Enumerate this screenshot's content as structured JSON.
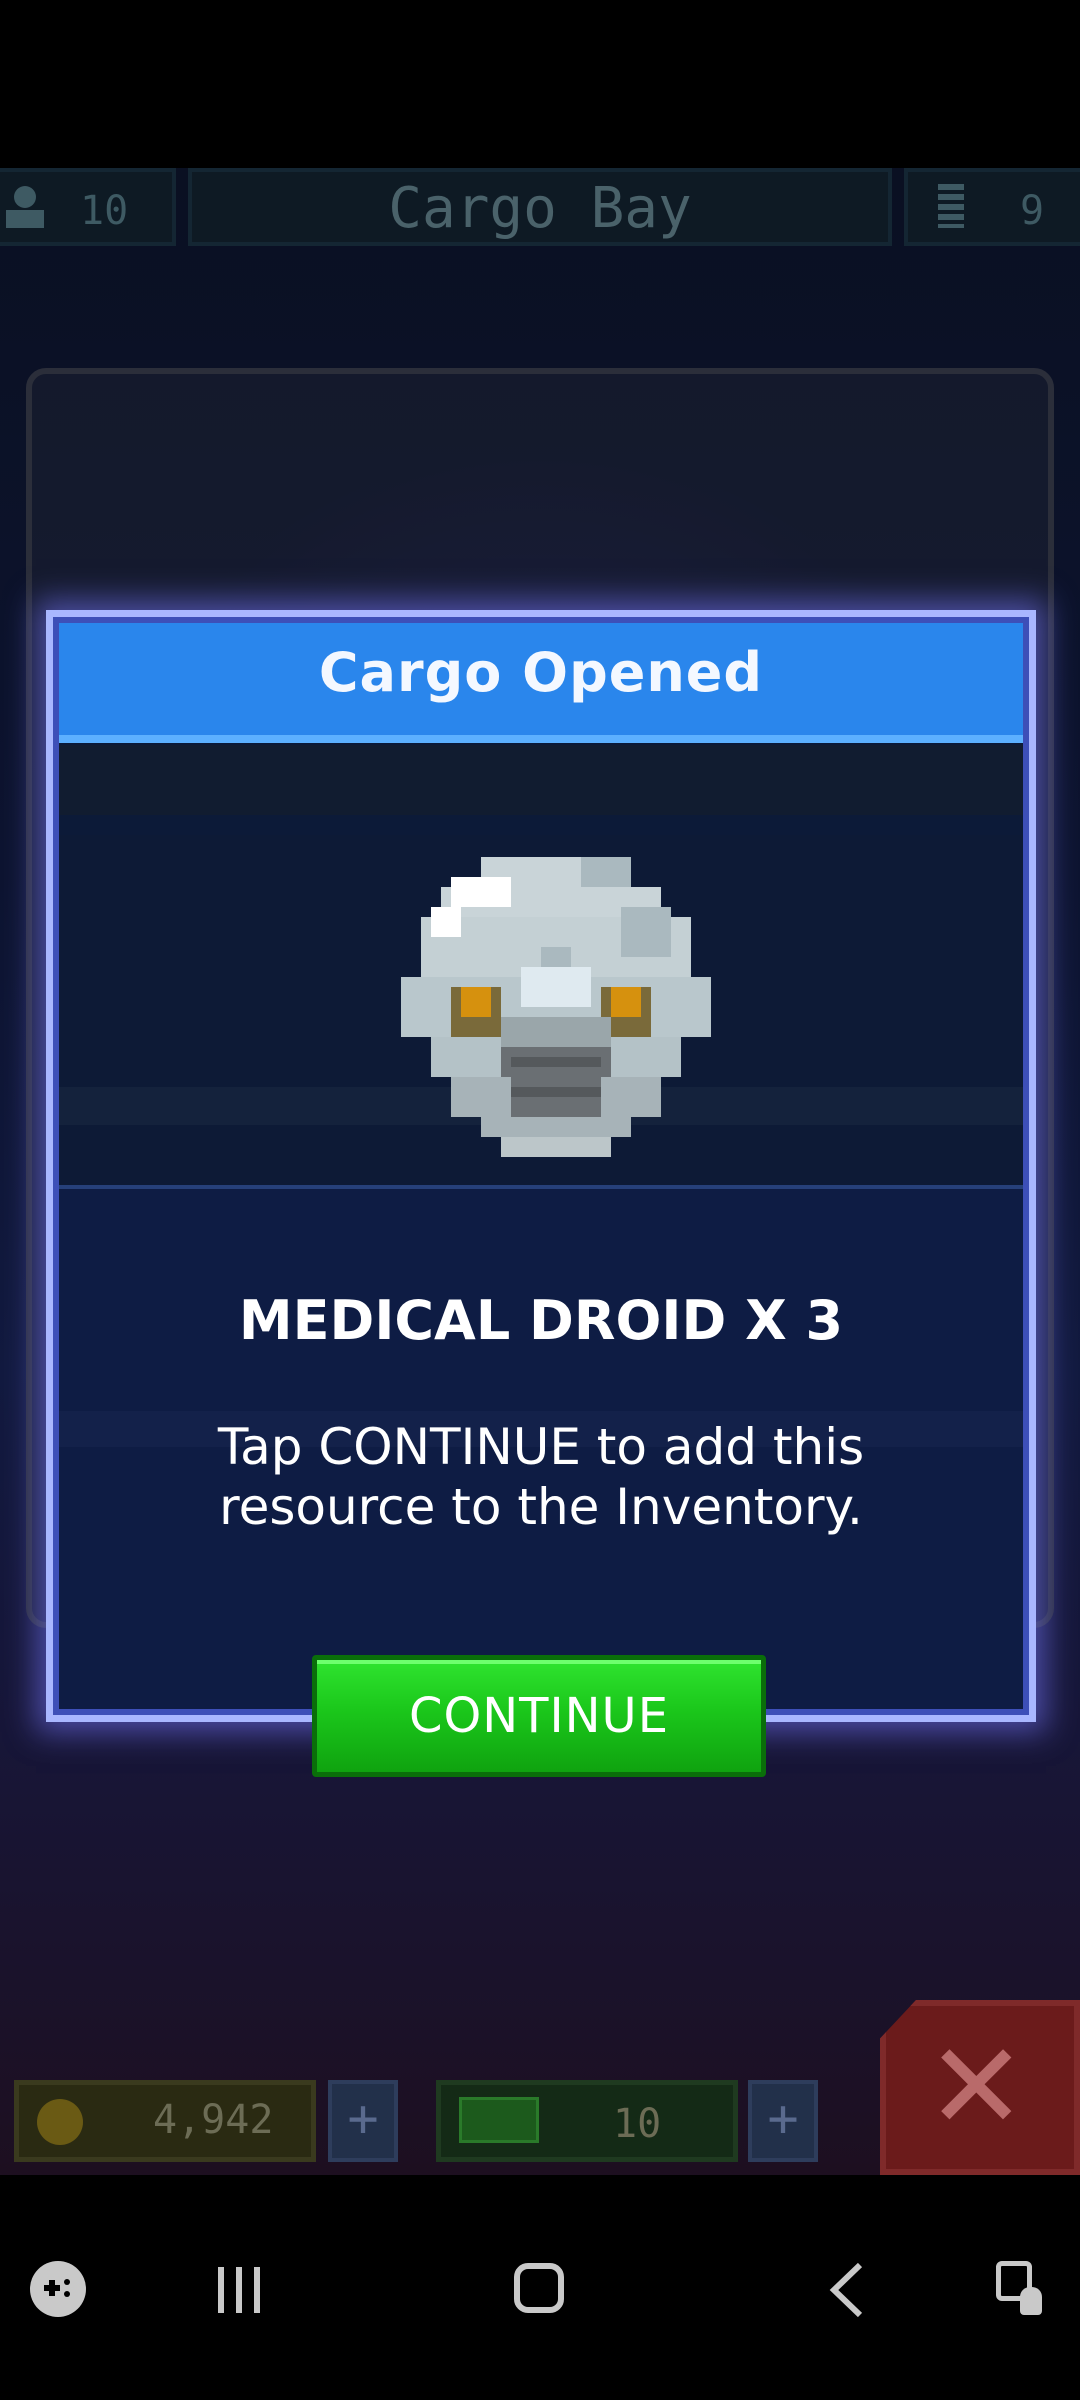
{
  "top_bar": {
    "crew_count": "10",
    "room_title": "Cargo Bay",
    "floor_count": "9"
  },
  "modal": {
    "title": "Cargo Opened",
    "item_name": "MEDICAL DROID X 3",
    "description": "Tap CONTINUE to add this resource to the Inventory.",
    "continue_label": "CONTINUE"
  },
  "resources": {
    "coins": "4,942",
    "tokens": "10"
  },
  "colors": {
    "header_blue": "#2a86ec",
    "continue_green": "#1bc71b",
    "modal_border": "#a9b7ff"
  },
  "icons": [
    "person-icon",
    "elevator-icon",
    "coin-icon",
    "token-icon",
    "plus-icon",
    "close-icon",
    "game-launcher-icon",
    "recent-apps-icon",
    "home-icon",
    "back-icon",
    "assistant-icon"
  ]
}
